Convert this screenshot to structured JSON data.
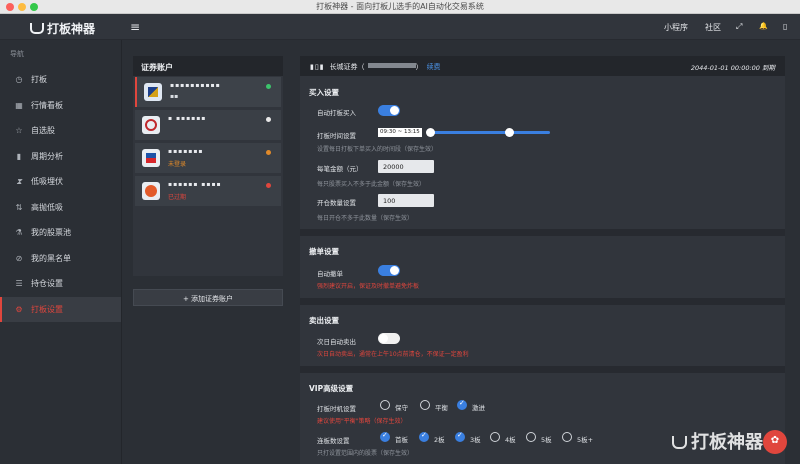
{
  "window": {
    "title": "打板神器 - 面向打板儿选手的AI自动化交易系统"
  },
  "topbar": {
    "logo": "打板神器",
    "menu_icon": "≡",
    "mini": "小程序",
    "community": "社区",
    "expand_icon": "⤢",
    "bell_icon": "🔔",
    "phone_icon": "▯"
  },
  "sidebar": {
    "heading": "导航",
    "items": [
      {
        "label": "打板",
        "icon": "◷"
      },
      {
        "label": "行情看板",
        "icon": "▦"
      },
      {
        "label": "自选股",
        "icon": "☆"
      },
      {
        "label": "周期分析",
        "icon": "▮"
      },
      {
        "label": "低吸埋伏",
        "icon": "⧗"
      },
      {
        "label": "高抛低吸",
        "icon": "⇅"
      },
      {
        "label": "我的股票池",
        "icon": "⚗"
      },
      {
        "label": "我的黑名单",
        "icon": "⊘"
      },
      {
        "label": "持仓设置",
        "icon": "☰"
      },
      {
        "label": "打板设置",
        "icon": "⚙"
      }
    ]
  },
  "accounts": {
    "title": "证券账户",
    "add_label": "+ 添加证券账户",
    "items": [
      {
        "name": "▪▪▪▪▪▪▪▪▪▪",
        "status": "▪▪",
        "status_color": "#d9dde2",
        "dot": "#3cc46c"
      },
      {
        "name": "▪ ▪▪▪▪▪▪",
        "status": "",
        "status_color": "#d9dde2",
        "dot": "#e8e8e8"
      },
      {
        "name": "▪▪▪▪▪▪▪",
        "status": "未登录",
        "status_color": "#e08a2a",
        "dot": "#e08a2a"
      },
      {
        "name": "▪▪▪▪▪▪ ▪▪▪▪",
        "status": "已过期",
        "status_color": "#e0463d",
        "dot": "#e0463d"
      }
    ]
  },
  "main": {
    "broker": "长城证券（",
    "renew": "续费",
    "expire": "2044-01-01 00:00:00 到期",
    "buy": {
      "title": "买入设置",
      "auto_label": "自动打板买入",
      "time_label": "打板时间设置",
      "time_value": "09:30 ~ 13:15",
      "time_hint": "设置每日打板下单买入的时间段（保存生效）",
      "amount_label": "每笔金额（元）",
      "amount_value": "20000",
      "amount_hint": "每只股票买入不多于此金额（保存生效）",
      "count_label": "开仓数量设置",
      "count_value": "100",
      "count_hint": "每日开仓不多于此数量（保存生效）"
    },
    "cancel": {
      "title": "撤单设置",
      "auto_label": "自动撤单",
      "warn": "强烈建议开启，保证及时撤单避免炸板"
    },
    "sell": {
      "title": "卖出设置",
      "auto_label": "次日自动卖出",
      "warn": "次日自动卖出，通常在上午10点前清仓，不保证一定盈利"
    },
    "vip": {
      "title": "VIP高级设置",
      "timing_label": "打板时机设置",
      "timing_options": [
        "保守",
        "平衡",
        "激进"
      ],
      "timing_warn": "建议使用\"平衡\"策略（保存生效）",
      "board_label": "连板数设置",
      "board_options": [
        "首板",
        "2板",
        "3板",
        "4板",
        "5板",
        "5板+"
      ],
      "board_hint": "只打设置范围内的股票（保存生效）"
    }
  },
  "watermark": "打板神器"
}
